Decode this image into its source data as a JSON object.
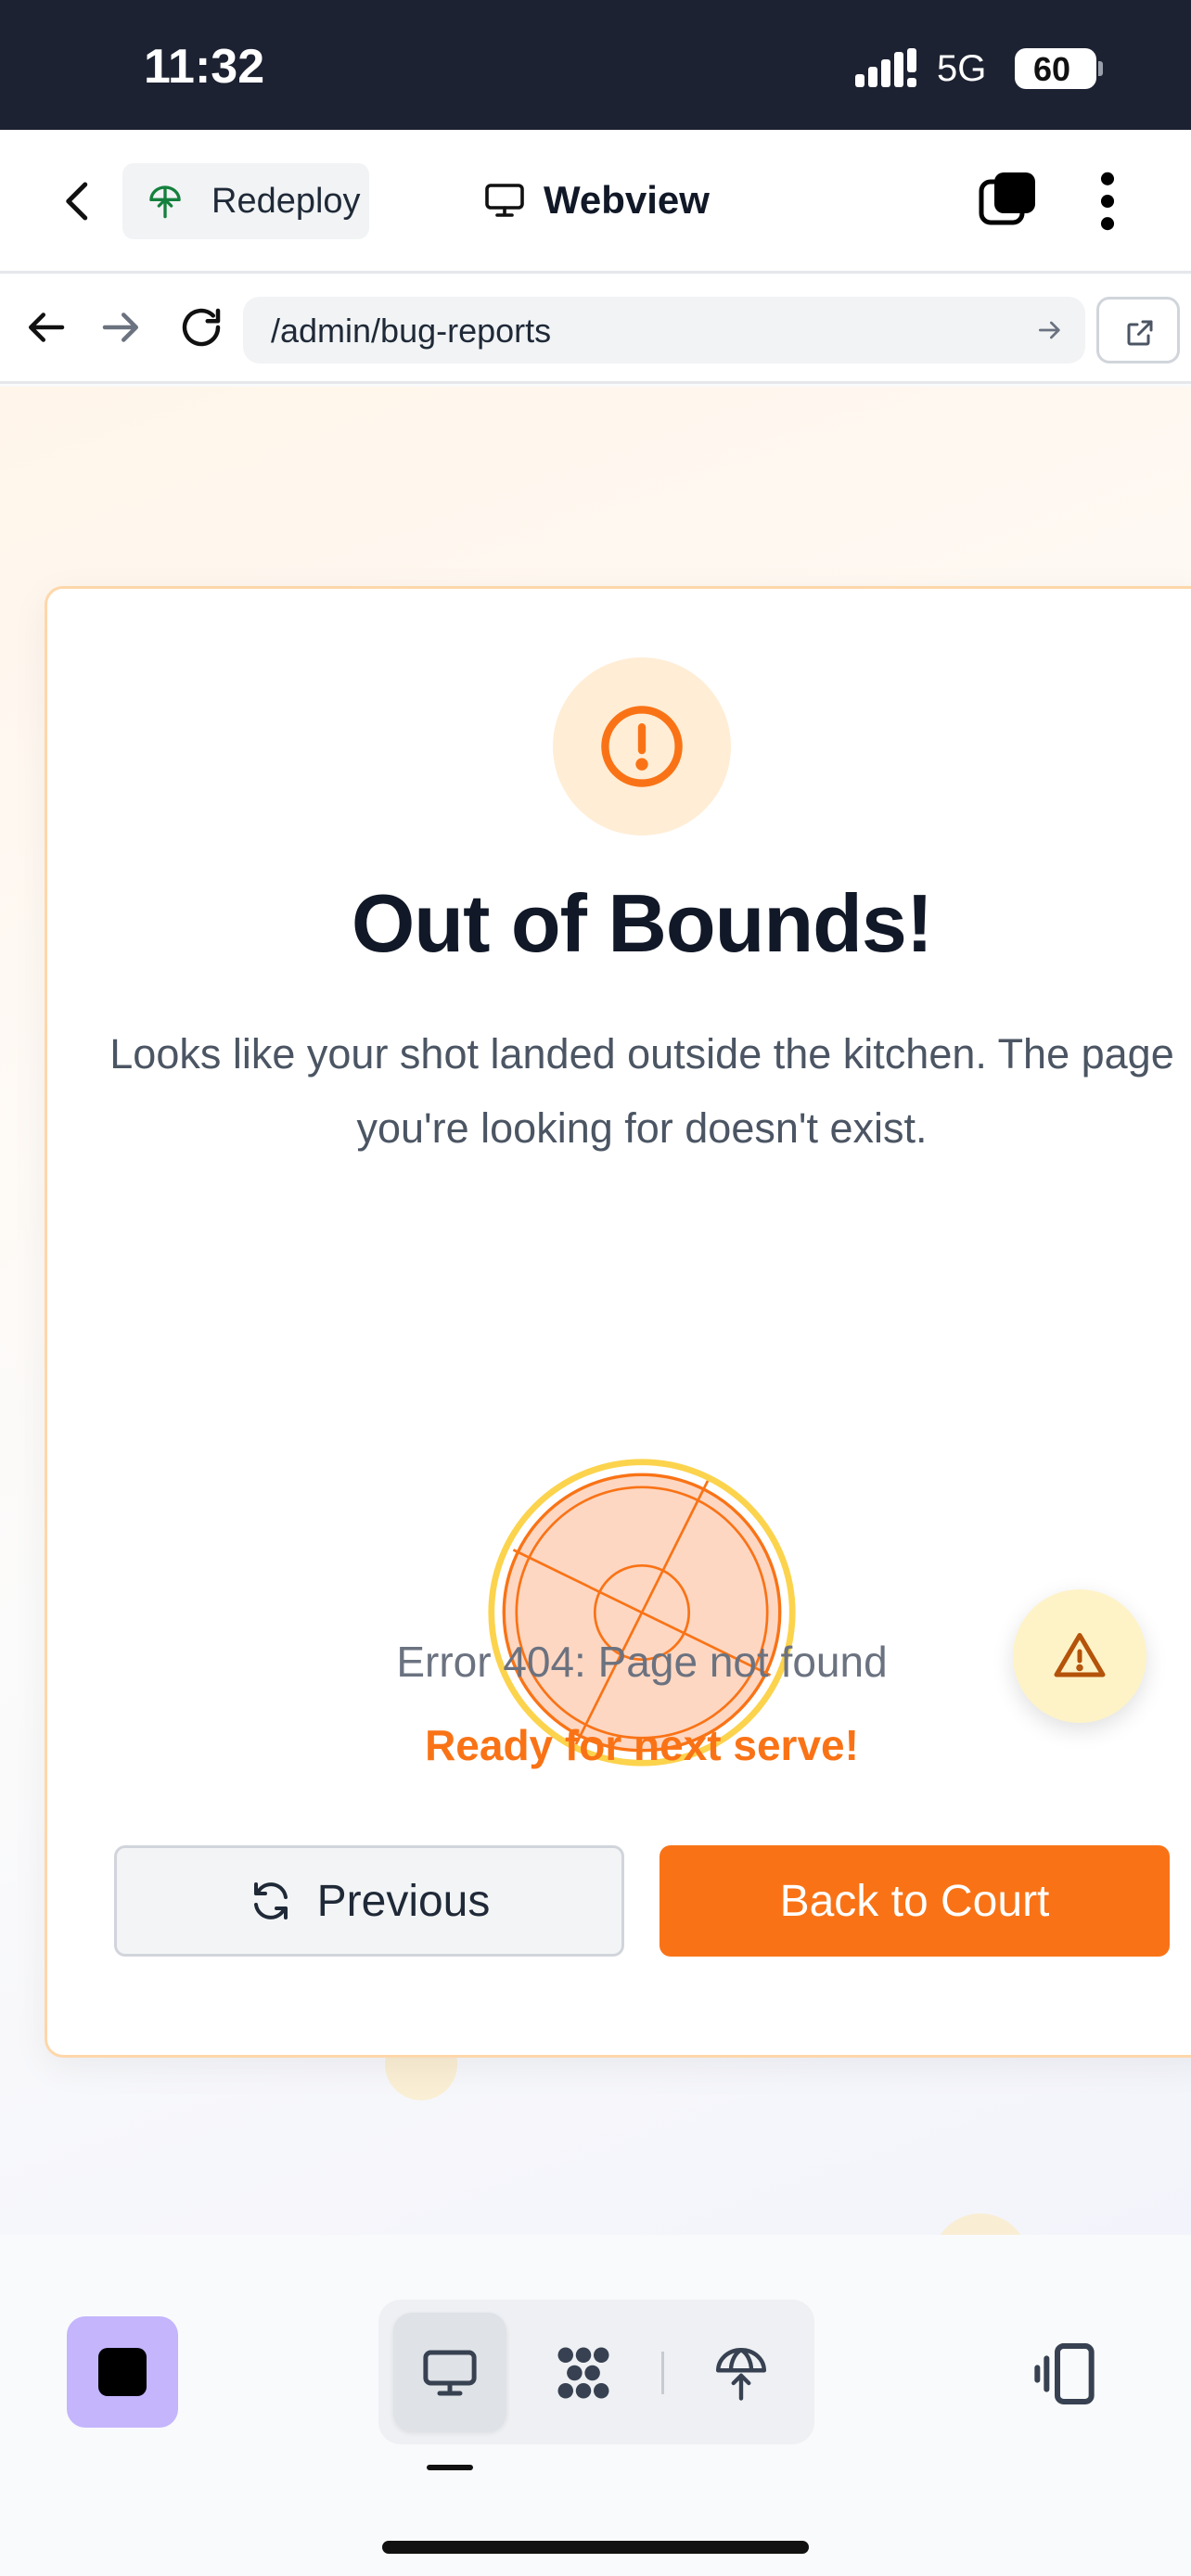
{
  "status_bar": {
    "time": "11:32",
    "network": "5G",
    "battery": "60"
  },
  "header": {
    "redeploy_label": "Redeploy",
    "title": "Webview"
  },
  "browser": {
    "url": "/admin/bug-reports"
  },
  "page": {
    "title": "Out of Bounds!",
    "description": "Looks like your shot landed outside the kitchen. The page you're looking for doesn't exist.",
    "error_code": "Error 404: Page not found",
    "message": "Ready for next serve!",
    "previous_label": "Previous",
    "back_label": "Back to Court"
  },
  "colors": {
    "accent": "#f97316",
    "accent_soft": "#ffedd5",
    "stop_button": "#c4b5fd",
    "status_bar": "#1d2232"
  },
  "icons": {
    "header": [
      "back-icon",
      "redeploy-icon",
      "monitor-icon",
      "tabs-icon",
      "more-icon"
    ],
    "browser": [
      "back-arrow-icon",
      "forward-arrow-icon",
      "reload-icon",
      "go-arrow-icon",
      "open-external-icon"
    ],
    "page": [
      "alert-circle-icon",
      "pickleball-icon",
      "refresh-icon",
      "warning-icon"
    ],
    "toolbar": [
      "stop-icon",
      "desktop-icon",
      "nodes-icon",
      "deploy-icon",
      "device-icon"
    ]
  }
}
